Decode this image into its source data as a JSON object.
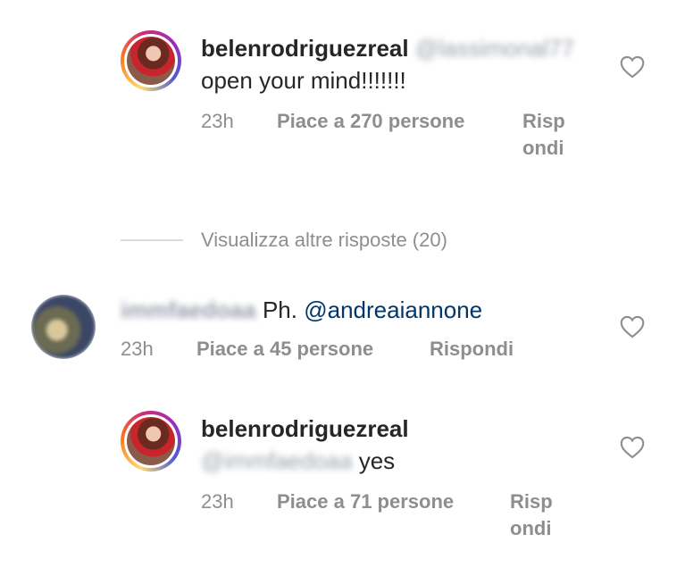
{
  "comments": [
    {
      "username": "belenrodriguezreal",
      "mention_blurred": "@lassimonal77",
      "text": "open your mind!!!!!!!",
      "time": "23h",
      "likes": "Piace a 270 persone",
      "reply": "Rispondi"
    },
    {
      "username_blurred": "immfaedoaa",
      "text_prefix": "Ph.",
      "mention": "@andreaiannone",
      "time": "23h",
      "likes": "Piace a 45 persone",
      "reply": "Rispondi"
    },
    {
      "username": "belenrodriguezreal",
      "mention_blurred": "@immfaedoaa",
      "text": "yes",
      "time": "23h",
      "likes": "Piace a 71 persone",
      "reply": "Rispondi"
    }
  ],
  "view_more": "Visualizza altre risposte (20)",
  "icons": {
    "like": "heart-outline-icon"
  },
  "colors": {
    "meta": "#8e8e8e",
    "mention": "#00376b",
    "text": "#262626"
  }
}
